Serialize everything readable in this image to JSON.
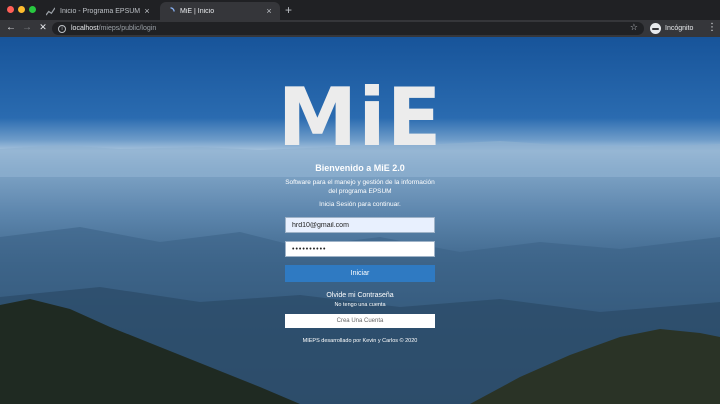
{
  "browser": {
    "tabs": [
      {
        "title": "Inicio - Programa EPSUM",
        "active": false
      },
      {
        "title": "MiE | Inicio",
        "active": true
      }
    ],
    "new_tab": "+",
    "close": "×",
    "url_host": "localhost",
    "url_path": "/mieps/public/login",
    "profile_label": "Incógnito",
    "icons": [
      "back-icon",
      "forward-icon",
      "stop-icon",
      "info-icon",
      "star-icon",
      "incognito-icon",
      "menu-icon"
    ]
  },
  "login": {
    "logo": "MiE",
    "welcome": "Bienvenido a MiE 2.0",
    "description": "Software para el manejo y gestión de la información del programa EPSUM",
    "prompt": "Inicia Sesión para continuar.",
    "email_value": "hrd10@gmail.com",
    "password_value": "••••••••••",
    "login_button": "Iniciar",
    "forgot_link": "Olvide mi Contraseña",
    "no_account": "No tengo una cuenta",
    "create_button": "Crea Una Cuenta",
    "footer": "MIEPS desarrollado por Kevin y Carlos © 2020"
  },
  "colors": {
    "primary_button": "#2f7ac2",
    "chrome_dark": "#202124",
    "chrome_toolbar": "#35363a"
  }
}
